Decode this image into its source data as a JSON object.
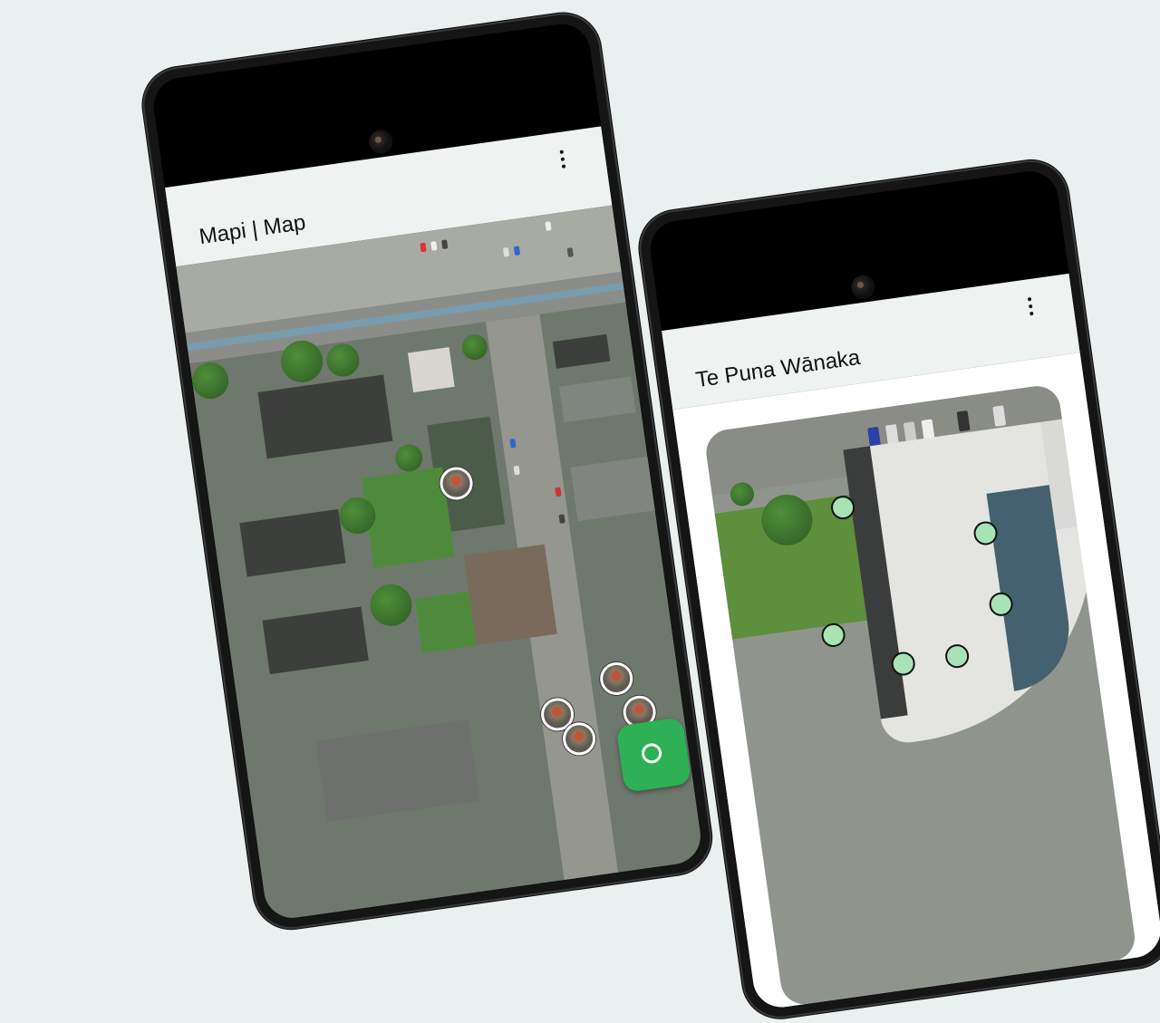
{
  "left_screen": {
    "title": "Mapi | Map",
    "menu_icon": "more-vert-icon",
    "fab_icon": "location-icon",
    "accent_color": "#2eb057"
  },
  "right_screen": {
    "title": "Te Puna Wānaka",
    "menu_icon": "more-vert-icon",
    "marker_color": "#a7e3b5"
  }
}
